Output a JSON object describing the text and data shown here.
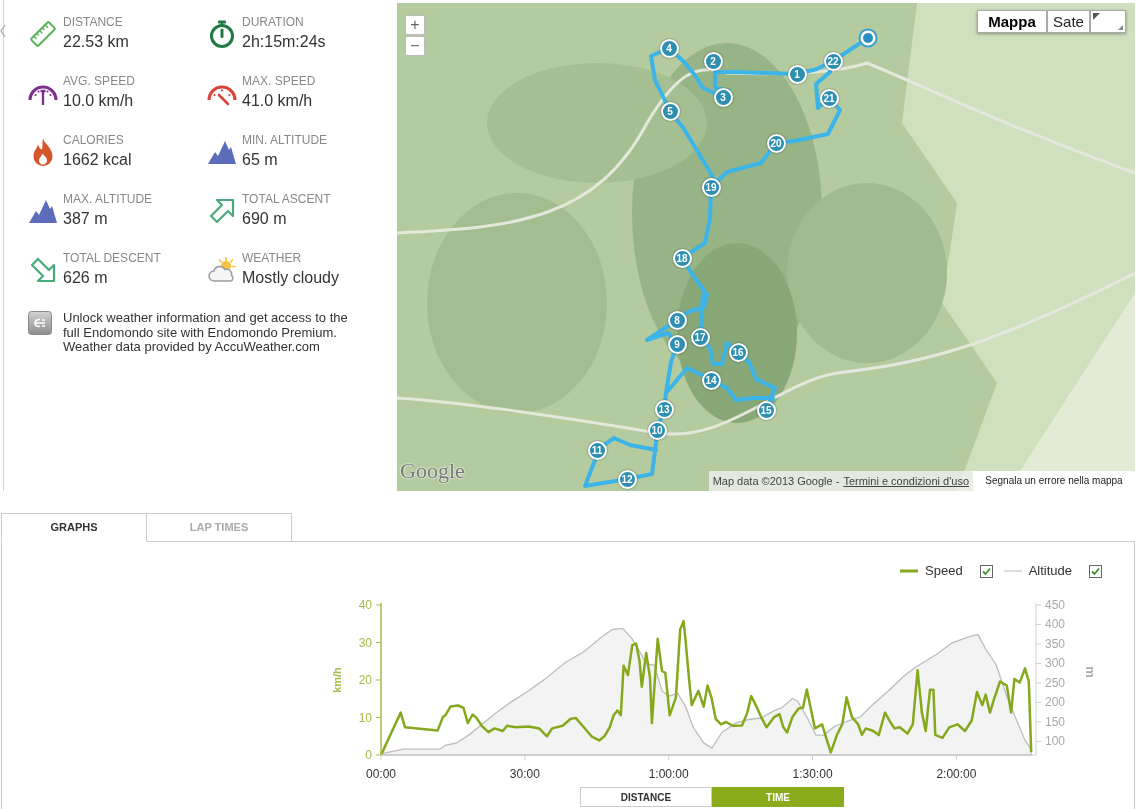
{
  "stats": [
    {
      "label": "DISTANCE",
      "value": "22.53 km"
    },
    {
      "label": "DURATION",
      "value": "2h:15m:24s"
    },
    {
      "label": "AVG. SPEED",
      "value": "10.0 km/h"
    },
    {
      "label": "MAX. SPEED",
      "value": "41.0 km/h"
    },
    {
      "label": "CALORIES",
      "value": "1662 kcal"
    },
    {
      "label": "MIN. ALTITUDE",
      "value": "65 m"
    },
    {
      "label": "MAX. ALTITUDE",
      "value": "387 m"
    },
    {
      "label": "TOTAL ASCENT",
      "value": "690 m"
    },
    {
      "label": "TOTAL DESCENT",
      "value": "626 m"
    },
    {
      "label": "WEATHER",
      "value": "Mostly cloudy"
    }
  ],
  "promo": {
    "text": "Unlock weather information and get access to the full Endomondo site with Endomondo Premium.",
    "credit": "Weather data provided by AccuWeather.com"
  },
  "map": {
    "zoom_buttons": [
      "+",
      "−"
    ],
    "map_types": [
      {
        "label": "Mappa",
        "selected": true
      },
      {
        "label": "Sate",
        "selected": false
      }
    ],
    "markers": [
      "1",
      "2",
      "3",
      "4",
      "5",
      "8",
      "9",
      "10",
      "11",
      "12",
      "13",
      "14",
      "15",
      "16",
      "17",
      "18",
      "19",
      "20",
      "21",
      "22"
    ],
    "logo": "Google",
    "attribution": "Map data ©2013 Google -",
    "terms_link": "Termini e condizioni d'uso",
    "report_link": "Segnala un errore nella mappa"
  },
  "tabs": [
    {
      "label": "GRAPHS",
      "selected": true
    },
    {
      "label": "LAP TIMES",
      "selected": false
    }
  ],
  "graphs": {
    "legend": [
      {
        "checked": true
      },
      {
        "checked": true
      }
    ],
    "chart_data": {
      "type": "line",
      "ylabel": "km/h",
      "y2label": "m",
      "xlim": [
        0,
        136.6
      ],
      "ylim": [
        0,
        40
      ],
      "y2lim": [
        65,
        450
      ],
      "yticks": [
        0,
        10,
        20,
        30,
        40
      ],
      "y2ticks": [
        100,
        150,
        200,
        250,
        300,
        350,
        400,
        450
      ],
      "xticks": [
        {
          "value": 0,
          "label": "00:00"
        },
        {
          "value": 30,
          "label": "30:00"
        },
        {
          "value": 60,
          "label": "1:00:00"
        },
        {
          "value": 90,
          "label": "1:30:00"
        },
        {
          "value": 120,
          "label": "2:00:00"
        }
      ],
      "x": [
        0,
        4.1,
        5.0,
        11.8,
        12.9,
        13.4,
        14.5,
        16.1,
        17.2,
        18.1,
        19.1,
        19.9,
        21.0,
        22.4,
        23.7,
        25.4,
        26.3,
        28.1,
        30.8,
        33.0,
        34.6,
        35.7,
        37.9,
        39.5,
        40.6,
        42.3,
        43.9,
        45.5,
        46.6,
        47.7,
        48.5,
        49.3,
        50.0,
        50.6,
        51.5,
        52.4,
        53.2,
        53.9,
        54.4,
        55.3,
        56.1,
        56.5,
        57.7,
        58.6,
        59.3,
        60.2,
        61.5,
        62.4,
        63.1,
        63.5,
        64.2,
        64.8,
        66.2,
        67.3,
        68.1,
        68.9,
        69.8,
        70.9,
        72.0,
        73.3,
        75.3,
        76.4,
        77.2,
        78.3,
        79.3,
        80.4,
        82.0,
        83.1,
        83.9,
        84.7,
        85.8,
        87.1,
        88.0,
        88.8,
        89.6,
        90.5,
        92.0,
        92.9,
        93.8,
        95.1,
        96.2,
        97.1,
        98.2,
        99.5,
        100.3,
        101.1,
        102.7,
        103.8,
        105.1,
        106.2,
        107.1,
        108.2,
        109.8,
        110.9,
        111.9,
        112.8,
        113.6,
        114.5,
        115.2,
        115.6,
        117.1,
        118.5,
        120.2,
        121.8,
        123.2,
        124.3,
        125.4,
        126.1,
        127.0,
        127.8,
        129.1,
        130.5,
        131.4,
        132.1,
        133.2,
        134.3,
        135.1,
        135.6
      ],
      "series": [
        {
          "name": "Speed",
          "color": "#86a81c",
          "values": [
            0,
            11.3,
            7.4,
            6.5,
            10.1,
            10.6,
            12.9,
            13.2,
            12.6,
            8.5,
            10.8,
            9.9,
            7.8,
            6.1,
            7.1,
            6.4,
            7.8,
            7.4,
            7.6,
            7.1,
            5.0,
            7.1,
            7.8,
            9.6,
            9.9,
            7.4,
            5.0,
            3.9,
            5.0,
            7.4,
            10.6,
            11.9,
            10.6,
            23.8,
            21.3,
            29.3,
            29.7,
            25.1,
            18.2,
            27.2,
            20.6,
            8.5,
            31.0,
            22.4,
            21.9,
            10.6,
            15.4,
            33.5,
            35.7,
            30.7,
            21.0,
            13.3,
            17.1,
            12.9,
            18.5,
            15.4,
            9.6,
            8.2,
            8.8,
            7.8,
            7.9,
            11.3,
            15.7,
            12.9,
            10.1,
            7.4,
            10.1,
            10.9,
            7.4,
            6.0,
            10.1,
            12.4,
            12.6,
            17.5,
            12.6,
            7.1,
            8.2,
            4.3,
            0.7,
            5.4,
            8.2,
            15.4,
            10.1,
            8.2,
            5.4,
            7.1,
            6.4,
            5.3,
            11.3,
            8.8,
            7.1,
            7.4,
            5.7,
            8.2,
            22.6,
            11.3,
            6.4,
            17.4,
            17.4,
            5.4,
            4.6,
            7.4,
            8.2,
            6.4,
            9.2,
            16.8,
            13.3,
            16.1,
            11.3,
            14.7,
            19.6,
            18.5,
            11.3,
            20.3,
            19.3,
            23.1,
            19.6,
            0.8
          ]
        },
        {
          "name": "Altitude",
          "color": "#bdbdbd",
          "type": "area",
          "axis": "y2",
          "x": [
            0,
            4.7,
            12.3,
            13.4,
            15.8,
            18.3,
            21.0,
            24.3,
            27.0,
            30.8,
            34.1,
            38.5,
            42.3,
            46.2,
            48.3,
            50.4,
            52.4,
            54.3,
            55.3,
            57.0,
            58.6,
            60.0,
            61.9,
            63.5,
            65.1,
            67.3,
            69.0,
            71.1,
            73.9,
            76.6,
            79.3,
            82.0,
            83.7,
            85.8,
            86.9,
            89.1,
            90.7,
            92.4,
            94.6,
            97.3,
            100.0,
            102.7,
            106.0,
            109.3,
            111.5,
            115.8,
            119.1,
            123.0,
            124.5,
            126.1,
            128.3,
            130.5,
            132.7,
            134.3,
            135.6
          ],
          "values": [
            68,
            80,
            80,
            90,
            96,
            116,
            143,
            176,
            200,
            230,
            259,
            303,
            330,
            370,
            387,
            390,
            363,
            323,
            299,
            296,
            230,
            216,
            223,
            190,
            136,
            96,
            83,
            123,
            147,
            156,
            160,
            179,
            187,
            210,
            203,
            156,
            116,
            116,
            139,
            152,
            163,
            196,
            232,
            270,
            290,
            323,
            353,
            370,
            374,
            337,
            296,
            216,
            150,
            103,
            80
          ]
        }
      ]
    },
    "axis_buttons": [
      {
        "label": "DISTANCE",
        "selected": false
      },
      {
        "label": "TIME",
        "selected": true
      }
    ]
  }
}
